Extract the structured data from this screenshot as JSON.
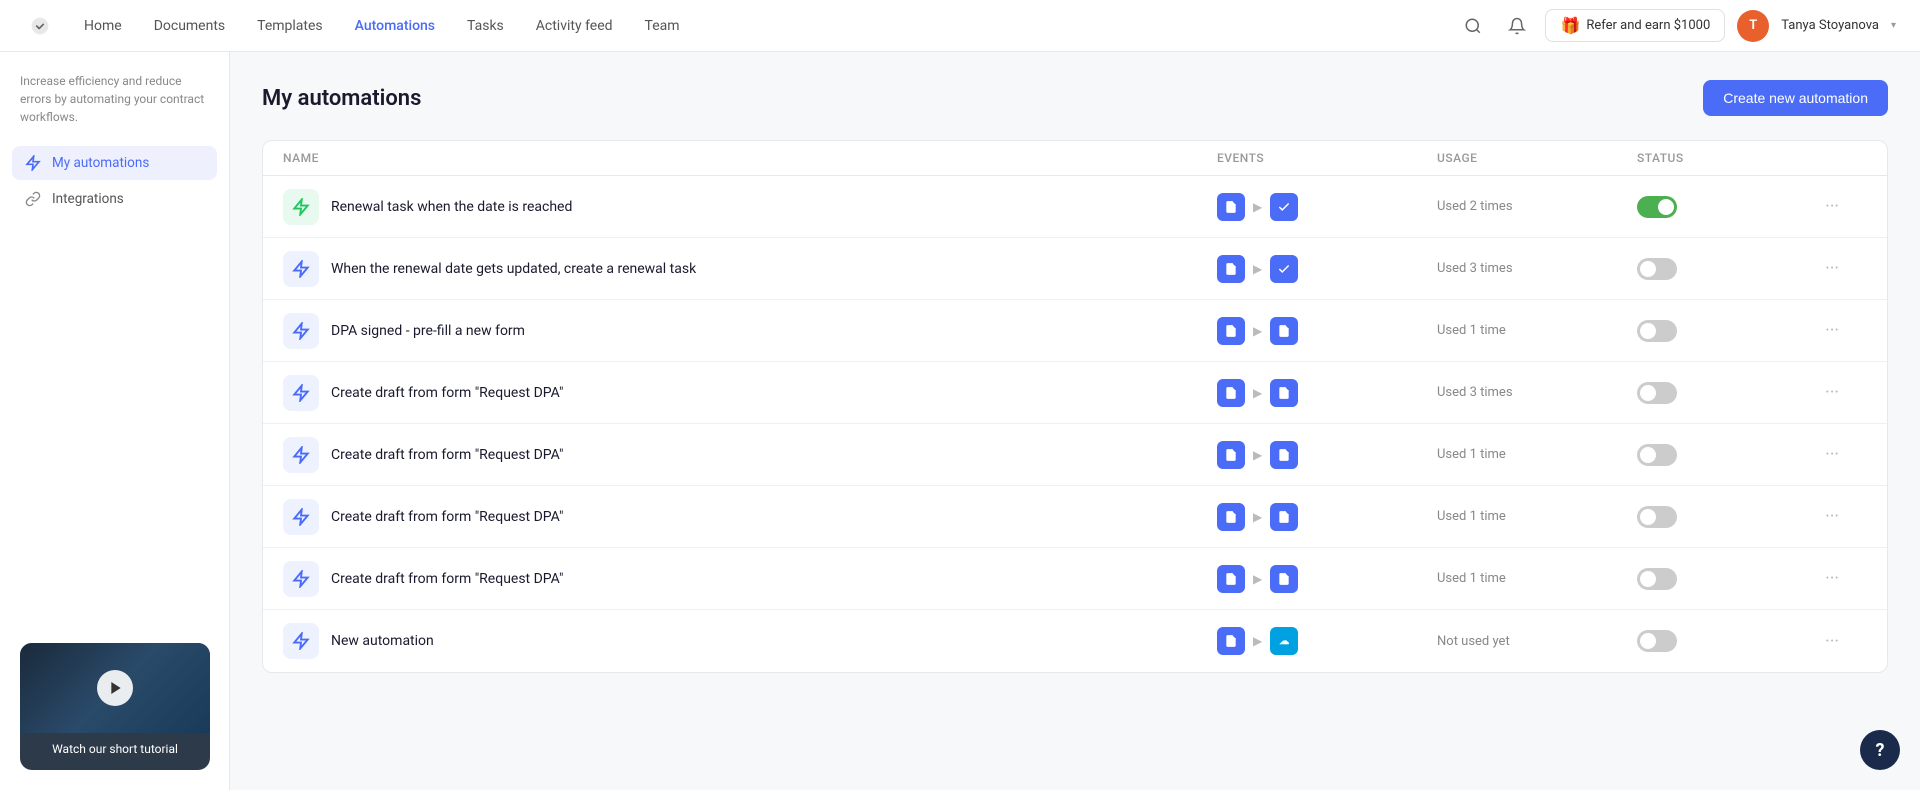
{
  "app": {
    "logo_label": "App Logo"
  },
  "nav": {
    "links": [
      {
        "id": "home",
        "label": "Home",
        "active": false
      },
      {
        "id": "documents",
        "label": "Documents",
        "active": false
      },
      {
        "id": "templates",
        "label": "Templates",
        "active": false
      },
      {
        "id": "automations",
        "label": "Automations",
        "active": true
      },
      {
        "id": "tasks",
        "label": "Tasks",
        "active": false
      },
      {
        "id": "activity-feed",
        "label": "Activity feed",
        "active": false
      },
      {
        "id": "team",
        "label": "Team",
        "active": false
      }
    ],
    "refer_label": "Refer and earn $1000",
    "user_name": "Tanya Stoyanova"
  },
  "sidebar": {
    "description": "Increase efficiency and reduce errors by automating your contract workflows.",
    "items": [
      {
        "id": "my-automations",
        "label": "My automations",
        "active": true,
        "icon": "bolt-icon"
      },
      {
        "id": "integrations",
        "label": "Integrations",
        "active": false,
        "icon": "link-icon"
      }
    ]
  },
  "page": {
    "title": "My automations",
    "create_btn_label": "Create new automation"
  },
  "table": {
    "columns": [
      "Name",
      "Events",
      "Usage",
      "Status"
    ],
    "rows": [
      {
        "id": 1,
        "name": "Renewal task when the date is reached",
        "icon_color": "green",
        "icon_type": "bolt",
        "event_trigger": "doc",
        "event_action": "checkbox",
        "usage": "Used 2 times",
        "enabled": true,
        "salesforce": false
      },
      {
        "id": 2,
        "name": "When the renewal date gets updated, create a renewal task",
        "icon_color": "blue",
        "icon_type": "bolt",
        "event_trigger": "doc",
        "event_action": "checkbox",
        "usage": "Used 3 times",
        "enabled": false,
        "salesforce": false
      },
      {
        "id": 3,
        "name": "DPA signed - pre-fill a new form",
        "icon_color": "blue",
        "icon_type": "bolt",
        "event_trigger": "doc",
        "event_action": "doc2",
        "usage": "Used 1 time",
        "enabled": false,
        "salesforce": false
      },
      {
        "id": 4,
        "name": "Create draft from form \"Request DPA\"",
        "icon_color": "blue",
        "icon_type": "bolt",
        "event_trigger": "doc",
        "event_action": "doc",
        "usage": "Used 3 times",
        "enabled": false,
        "salesforce": false
      },
      {
        "id": 5,
        "name": "Create draft from form \"Request DPA\"",
        "icon_color": "blue",
        "icon_type": "bolt",
        "event_trigger": "doc",
        "event_action": "doc",
        "usage": "Used 1 time",
        "enabled": false,
        "salesforce": false
      },
      {
        "id": 6,
        "name": "Create draft from form \"Request DPA\"",
        "icon_color": "blue",
        "icon_type": "bolt",
        "event_trigger": "doc",
        "event_action": "doc",
        "usage": "Used 1 time",
        "enabled": false,
        "salesforce": false
      },
      {
        "id": 7,
        "name": "Create draft from form \"Request DPA\"",
        "icon_color": "blue",
        "icon_type": "bolt",
        "event_trigger": "doc",
        "event_action": "doc",
        "usage": "Used 1 time",
        "enabled": false,
        "salesforce": false
      },
      {
        "id": 8,
        "name": "New automation",
        "icon_color": "blue",
        "icon_type": "bolt",
        "event_trigger": "doc",
        "event_action": "salesforce",
        "usage": "Not used yet",
        "enabled": false,
        "salesforce": true
      }
    ]
  },
  "tutorial": {
    "label": "Watch our short tutorial",
    "close_label": "×"
  },
  "help": {
    "label": "?"
  }
}
